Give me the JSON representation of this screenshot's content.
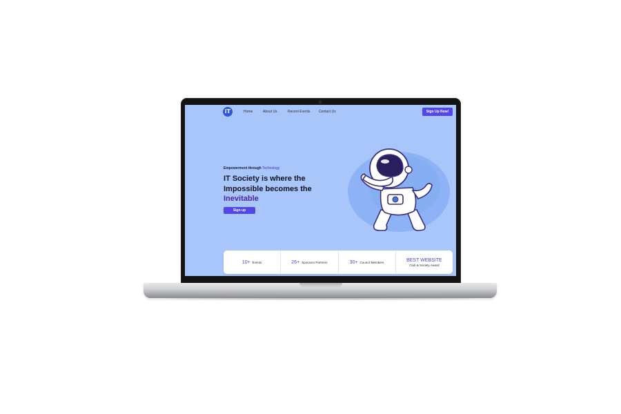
{
  "nav": {
    "logo_text": "iT",
    "links": [
      "Home",
      "About Us",
      "Recent Events",
      "Contact Us"
    ],
    "cta_label": "Sign Up Now!"
  },
  "hero": {
    "tagline_prefix": "Empowerment through ",
    "tagline_accent": "Technology",
    "headline_main": "IT Society is where the Impossible becomes the",
    "headline_accent": "Inevitable",
    "button_label": "Sign up"
  },
  "stats": [
    {
      "number": "10+",
      "label": "Events"
    },
    {
      "number": "26+",
      "label": "Sponsors Partners"
    },
    {
      "number": "30+",
      "label": "Council Members"
    }
  ],
  "award": {
    "title": "BEST WEBSITE",
    "subtitle": "Club & Society Award"
  },
  "colors": {
    "screen_bg": "#a9c6fb",
    "accent": "#5247e6",
    "logo": "#2d56d8",
    "headline_accent": "#4a1fa3"
  }
}
